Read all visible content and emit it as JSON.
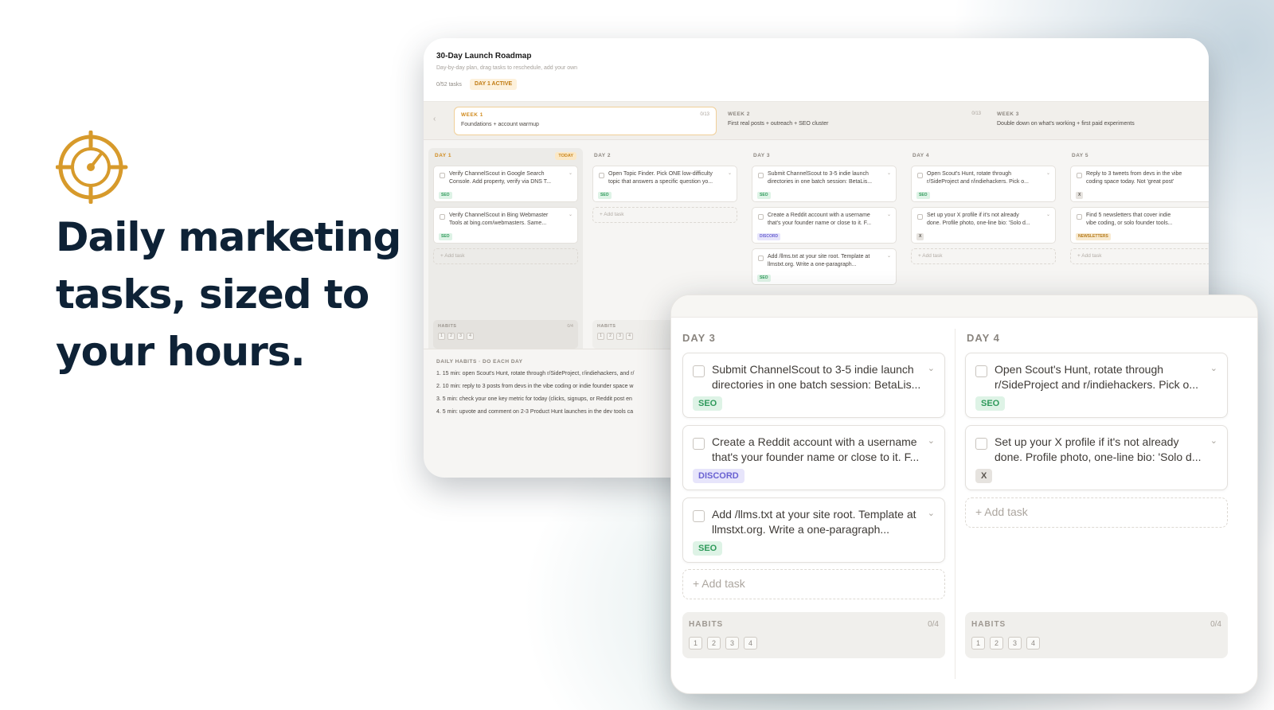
{
  "headline": {
    "line1": "Daily marketing",
    "line2": "tasks, sized to",
    "line3": "your hours."
  },
  "brand": {
    "accent": "#D79A2B",
    "text": "#0E2236",
    "icon": "target-crosshair-icon"
  },
  "roadmap": {
    "title": "30-Day Launch Roadmap",
    "subtitle": "Day-by-day plan, drag tasks to reschedule, add your own",
    "task_count": "0/52 tasks",
    "active_badge": "DAY 1 ACTIVE",
    "weeks": [
      {
        "name": "WEEK 1",
        "desc": "Foundations + account warmup",
        "count": "0/13"
      },
      {
        "name": "WEEK 2",
        "desc": "First real posts + outreach + SEO cluster",
        "count": "0/13"
      },
      {
        "name": "WEEK 3",
        "desc": "Double down on what's working + first paid experiments",
        "count": ""
      }
    ],
    "days": [
      {
        "title": "DAY 1",
        "today": "TODAY",
        "tasks": [
          {
            "l1": "Verify ChannelScout in Google Search",
            "l2": "Console. Add property, verify via DNS T...",
            "tag": "SEO"
          },
          {
            "l1": "Verify ChannelScout in Bing Webmaster",
            "l2": "Tools at bing.com/webmasters. Same...",
            "tag": "SEO"
          }
        ],
        "habits_label": "HABITS",
        "habits_count": "0/4"
      },
      {
        "title": "DAY 2",
        "tasks": [
          {
            "l1": "Open Topic Finder. Pick ONE low-difficulty",
            "l2": "topic that answers a specific question yo...",
            "tag": "SEO"
          }
        ],
        "habits_label": "HABITS",
        "habits_count": "0/4"
      },
      {
        "title": "DAY 3",
        "tasks": [
          {
            "l1": "Submit ChannelScout to 3-5 indie launch",
            "l2": "directories in one batch session: BetaLis...",
            "tag": "SEO"
          },
          {
            "l1": "Create a Reddit account with a username",
            "l2": "that's your founder name or close to it. F...",
            "tag": "DISCORD"
          },
          {
            "l1": "Add /llms.txt at your site root. Template at",
            "l2": "llmstxt.org. Write a one-paragraph...",
            "tag": "SEO"
          }
        ]
      },
      {
        "title": "DAY 4",
        "tasks": [
          {
            "l1": "Open Scout's Hunt, rotate through",
            "l2": "r/SideProject and r/indiehackers. Pick o...",
            "tag": "SEO"
          },
          {
            "l1": "Set up your X profile if it's not already",
            "l2": "done. Profile photo, one-line bio: 'Solo d...",
            "tag": "X"
          }
        ]
      },
      {
        "title": "DAY 5",
        "tasks": [
          {
            "l1": "Reply to 3 tweets from devs in the vibe",
            "l2": "coding space today. Not 'great post'",
            "tag": "X"
          },
          {
            "l1": "Find 5 newsletters that cover indie",
            "l2": "vibe coding, or solo founder tools...",
            "tag": "NEWSLETTERS"
          }
        ]
      }
    ],
    "add_task": "+ Add task",
    "daily_habits_title": "DAILY HABITS · DO EACH DAY",
    "daily_habits": [
      "1.  15 min: open Scout's Hunt, rotate through r/SideProject, r/indiehackers, and r/",
      "2.  10 min: reply to 3 posts from devs in the vibe coding or indie founder space w",
      "3.  5 min: check your one key metric for today (clicks, signups, or Reddit post en",
      "4.  5 min: upvote and comment on 2-3 Product Hunt launches in the dev tools ca"
    ]
  },
  "zoom": {
    "columns": [
      {
        "title": "DAY 3",
        "tasks": [
          {
            "l1": "Submit ChannelScout to 3-5 indie launch",
            "l2": "directories in one batch session: BetaLis...",
            "tag": "SEO"
          },
          {
            "l1": "Create a Reddit account with a username",
            "l2": "that's your founder name or close to it. F...",
            "tag": "DISCORD"
          },
          {
            "l1": "Add /llms.txt at your site root. Template at",
            "l2": "llmstxt.org. Write a one-paragraph...",
            "tag": "SEO"
          }
        ],
        "add_task": "+ Add task",
        "habits_label": "HABITS",
        "habits_count": "0/4",
        "habits": [
          "1",
          "2",
          "3",
          "4"
        ]
      },
      {
        "title": "DAY 4",
        "tasks": [
          {
            "l1": "Open Scout's Hunt, rotate through",
            "l2": "r/SideProject and r/indiehackers. Pick o...",
            "tag": "SEO"
          },
          {
            "l1": "Set up your X profile if it's not already",
            "l2": "done. Profile photo, one-line bio: 'Solo d...",
            "tag": "X"
          }
        ],
        "add_task": "+ Add task",
        "habits_label": "HABITS",
        "habits_count": "0/4",
        "habits": [
          "1",
          "2",
          "3",
          "4"
        ]
      }
    ]
  }
}
